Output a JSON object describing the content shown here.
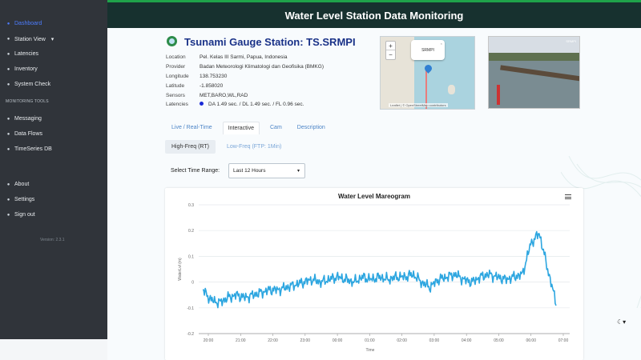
{
  "app": {
    "header_title": "Water Level Station Data Monitoring",
    "version": "Version: 2.3.1"
  },
  "sidebar": {
    "items_top": [
      {
        "label": "Dashboard",
        "icon": "dashboard-icon",
        "active": true
      },
      {
        "label": "Station View",
        "icon": "station-icon"
      },
      {
        "label": "Latencies",
        "icon": "clock-icon"
      },
      {
        "label": "Inventory",
        "icon": "box-icon"
      },
      {
        "label": "System Check",
        "icon": "check-icon"
      }
    ],
    "section_label": "MONITORING TOOLS",
    "items_tools": [
      {
        "label": "Messaging",
        "icon": "message-icon"
      },
      {
        "label": "Data Flows",
        "icon": "flow-icon"
      },
      {
        "label": "TimeSeries DB",
        "icon": "database-icon"
      }
    ],
    "items_bottom": [
      {
        "label": "About",
        "icon": "info-icon"
      },
      {
        "label": "Settings",
        "icon": "gear-icon"
      },
      {
        "label": "Sign out",
        "icon": "signout-icon"
      }
    ]
  },
  "station": {
    "title": "Tsunami Gauge Station: TS.SRMPI",
    "fields": [
      {
        "key": "Location",
        "value": "Pel. Kelas III Sarmi, Papua, Indonesia"
      },
      {
        "key": "Provider",
        "value": "Badan Meteorologi Klimatologi dan Geofisika (BMKG)"
      },
      {
        "key": "Longitude",
        "value": "138.753230"
      },
      {
        "key": "Latitude",
        "value": "-1.858020"
      },
      {
        "key": "Sensors",
        "value": "MET,BARO,WL,RAD"
      },
      {
        "key": "Latencies",
        "value": "DA 1.49 sec. / DL 1.49 sec. / FL 0.96 sec."
      }
    ]
  },
  "map": {
    "zoom_in": "+",
    "zoom_out": "−",
    "popup": "SRMPI",
    "popup_close": "×",
    "attribution": "Leaflet | © OpenStreetMap contributors"
  },
  "camera": {
    "stamp": "SRMPI"
  },
  "tabs": [
    "Live / Real-Time",
    "Interactive",
    "Cam",
    "Description"
  ],
  "active_tab": "Interactive",
  "subtabs": [
    "High-Freq (RT)",
    "Low-Freq (FTP: 1Min)"
  ],
  "active_subtab": "High-Freq (RT)",
  "controls": {
    "range_label": "Select Time Range:",
    "range_value": "Last 12 Hours"
  },
  "chart_data": {
    "type": "line",
    "title": "Water Level Mareogram",
    "xlabel": "Time",
    "ylabel": "WaterLvl (m)",
    "x": [
      "20:00",
      "21:00",
      "22:00",
      "23:00",
      "00:00",
      "01:00",
      "02:00",
      "03:00",
      "04:00",
      "05:00",
      "06:00",
      "07:00"
    ],
    "ylim": [
      -0.2,
      0.3
    ],
    "yticks": [
      0.3,
      0.2,
      0.1,
      0,
      -0.1,
      -0.2
    ],
    "series": [
      {
        "values": [
          -0.03,
          -0.07,
          -0.08,
          -0.06,
          -0.05,
          -0.06,
          -0.05,
          -0.04,
          -0.03,
          -0.03,
          -0.02,
          -0.01,
          0.0,
          0.01,
          0.0,
          0.01,
          0.02,
          0.01,
          0.0,
          0.02,
          0.01,
          0.02,
          0.01,
          0.02,
          0.02,
          0.03,
          0.0,
          -0.02,
          0.01,
          0.02,
          0.03,
          0.01,
          0.0,
          0.02,
          0.03,
          0.02,
          0.01,
          0.02,
          0.03,
          0.15,
          0.19,
          0.05,
          -0.08
        ],
        "color": "#2da6e0"
      }
    ]
  },
  "icons": {
    "menu": "hamburger-icon",
    "theme": "moon-icon"
  }
}
